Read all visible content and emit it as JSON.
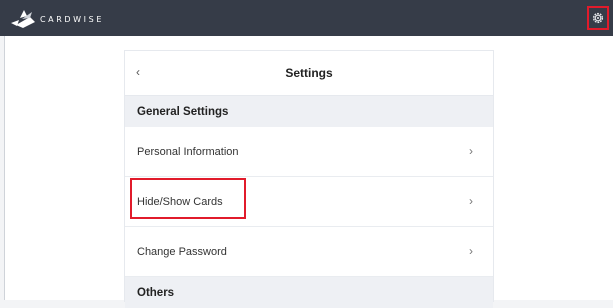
{
  "app": {
    "brand": "CARDWISE",
    "accent": "#e11b2b",
    "topbar_color": "#363c48"
  },
  "icons": {
    "logo": "cardwise-logo-icon",
    "settings": "gear-icon",
    "back": "chevron-left-icon",
    "row_arrow": "chevron-right-icon"
  },
  "settings": {
    "back_glyph": "‹",
    "title": "Settings",
    "sections": [
      {
        "label": "General Settings",
        "items": [
          {
            "label": "Personal Information",
            "chevron": "›"
          },
          {
            "label": "Hide/Show Cards",
            "chevron": "›"
          },
          {
            "label": "Change Password",
            "chevron": "›"
          }
        ]
      },
      {
        "label": "Others"
      }
    ]
  }
}
